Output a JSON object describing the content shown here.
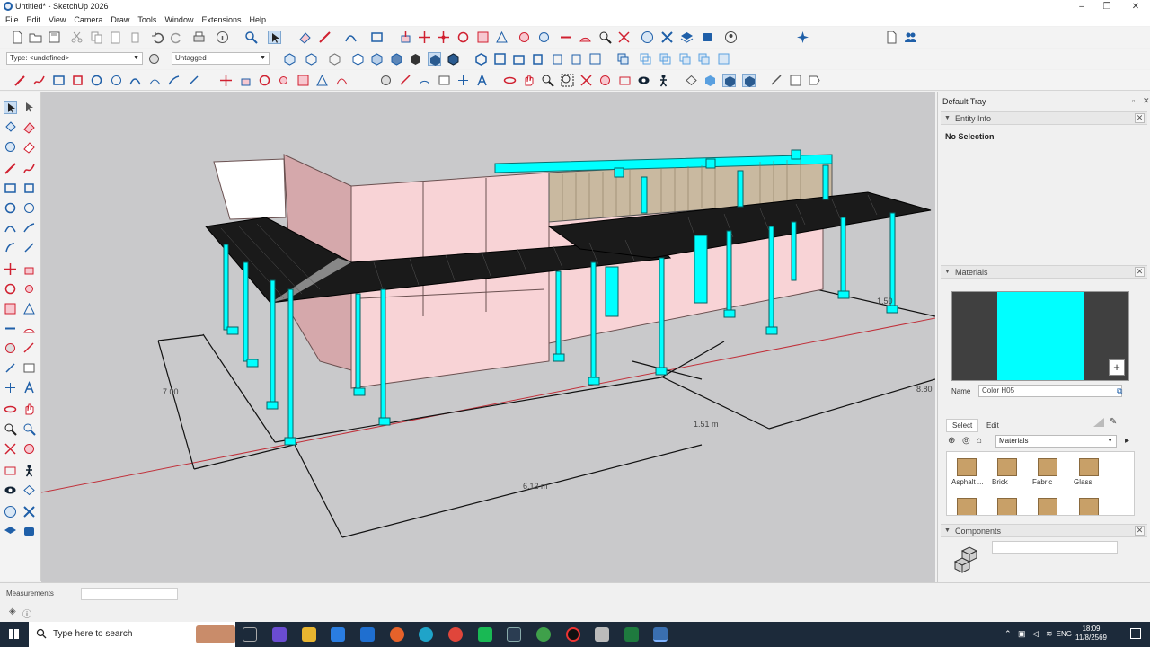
{
  "window": {
    "title": "Untitled* - SketchUp 2026"
  },
  "menu": [
    "File",
    "Edit",
    "View",
    "Camera",
    "Draw",
    "Tools",
    "Window",
    "Extensions",
    "Help"
  ],
  "toolbar": {
    "type_dropdown": "Type: <undefined>",
    "tag_dropdown": "Untagged"
  },
  "viewport": {
    "dims": {
      "d1": "7.00",
      "d2": "6.12 m",
      "d3": "1.51 m",
      "d4": "8.80",
      "d5": "1.50"
    },
    "colors": {
      "bg": "#c9c9cb",
      "wall": "#f5d0d4",
      "accent": "#00ffff",
      "axis_red": "#c0303a"
    }
  },
  "tray": {
    "title": "Default Tray",
    "entity_info": {
      "label": "Entity Info",
      "selection": "No Selection"
    },
    "materials": {
      "label": "Materials",
      "name_label": "Name",
      "name_value": "Color H05",
      "tabs": [
        "Select",
        "Edit"
      ],
      "library": "Materials",
      "items": [
        "Asphalt ...",
        "Brick",
        "Fabric",
        "Glass"
      ]
    },
    "components": {
      "label": "Components"
    }
  },
  "status": {
    "measurements_label": "Measurements"
  },
  "taskbar": {
    "search_placeholder": "Type here to search",
    "language": "ENG",
    "time": "18:09",
    "date": "11/8/2569"
  }
}
